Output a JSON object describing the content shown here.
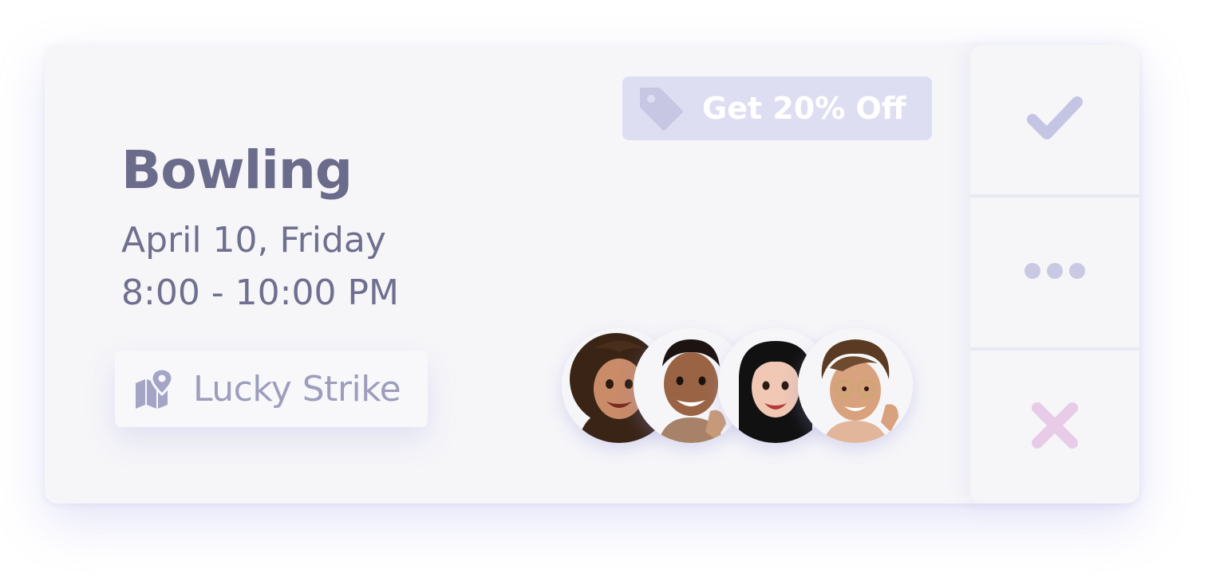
{
  "event": {
    "title": "Bowling",
    "date": "April 10, Friday",
    "time": "8:00  - 10:00 PM",
    "location": "Lucky Strike"
  },
  "promo": {
    "label": "Get 20% Off",
    "icon": "tag-icon"
  },
  "attendees": [
    {
      "name": "attendee-1",
      "hair": "#3a2416",
      "skin": "#c98b68"
    },
    {
      "name": "attendee-2",
      "hair": "#1d1412",
      "skin": "#9a6444"
    },
    {
      "name": "attendee-3",
      "hair": "#111111",
      "skin": "#f0c8b4"
    },
    {
      "name": "attendee-4",
      "hair": "#5a3a22",
      "skin": "#d9a27e"
    }
  ],
  "actions": {
    "accept_icon": "checkmark-icon",
    "more_icon": "more-dots-icon",
    "decline_icon": "close-icon"
  },
  "colors": {
    "card_bg": "#f6f6f9",
    "title": "#6b6b8b",
    "muted": "#9d9dbd",
    "promo_bg": "#dedef2",
    "accept": "#c4c4e4",
    "more": "#c9c9e4",
    "decline": "#e8cbe6"
  }
}
